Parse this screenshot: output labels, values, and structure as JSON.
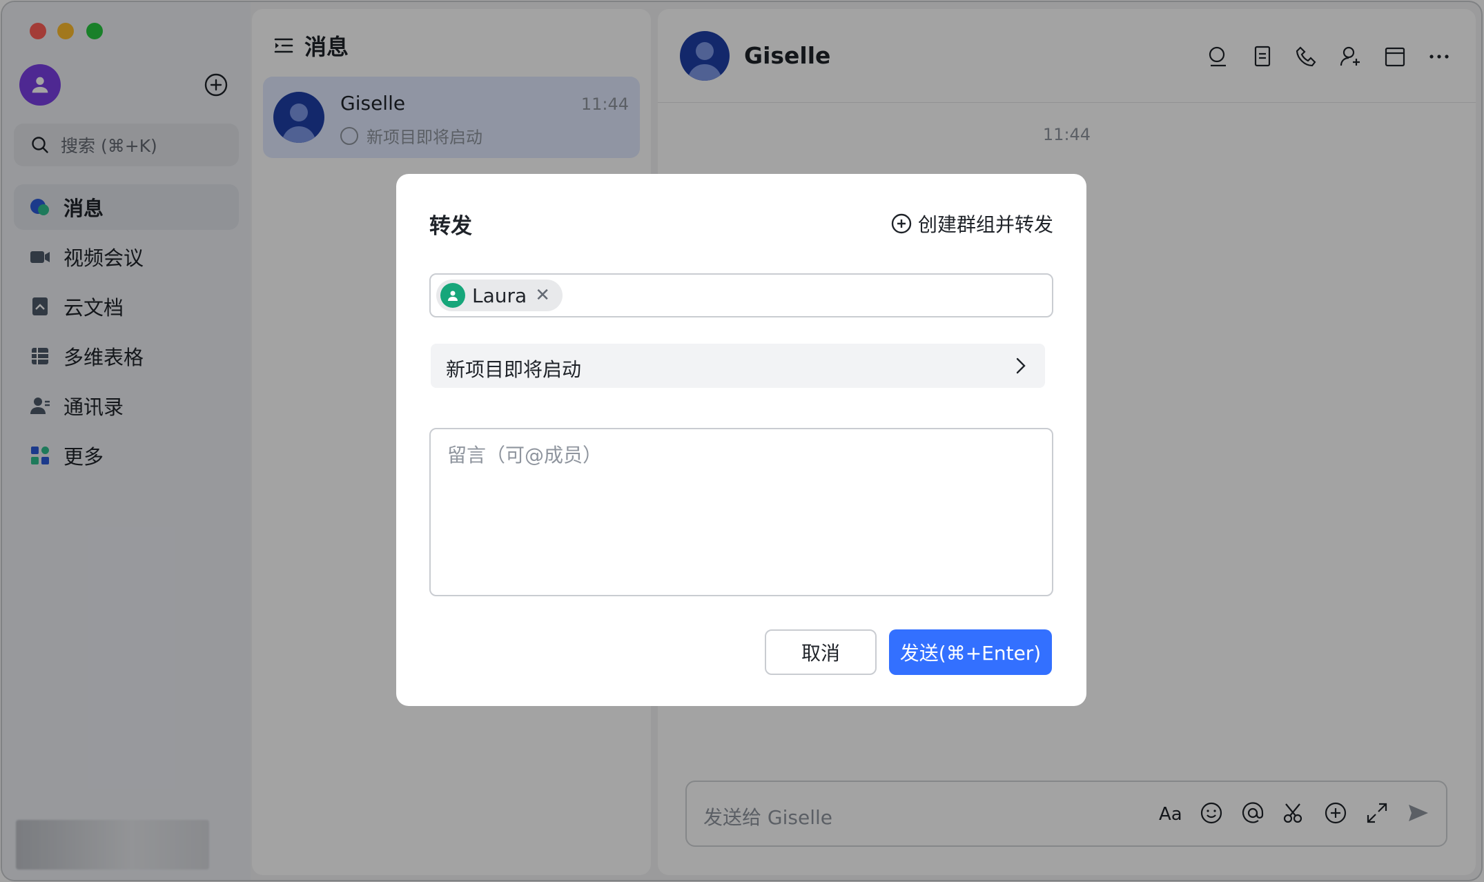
{
  "sidebar": {
    "search_placeholder": "搜索 (⌘+K)",
    "items": [
      {
        "label": "消息",
        "icon": "message-icon"
      },
      {
        "label": "视频会议",
        "icon": "video-icon"
      },
      {
        "label": "云文档",
        "icon": "doc-icon"
      },
      {
        "label": "多维表格",
        "icon": "table-icon"
      },
      {
        "label": "通讯录",
        "icon": "contacts-icon"
      },
      {
        "label": "更多",
        "icon": "more-apps-icon"
      }
    ]
  },
  "message_list": {
    "title": "消息",
    "chats": [
      {
        "name": "Giselle",
        "time": "11:44",
        "preview": "新项目即将启动"
      }
    ]
  },
  "chat": {
    "name": "Giselle",
    "timestamp": "11:44",
    "composer_placeholder": "发送给 Giselle"
  },
  "dialog": {
    "title": "转发",
    "create_group_label": "创建群组并转发",
    "recipient": "Laura",
    "forward_content": "新项目即将启动",
    "note_placeholder": "留言（可@成员）",
    "cancel_label": "取消",
    "send_label": "发送(⌘+Enter)"
  },
  "colors": {
    "accent": "#3370ff",
    "active_chat_bg": "#e1eaff",
    "recipient_avatar": "#16a67a"
  }
}
